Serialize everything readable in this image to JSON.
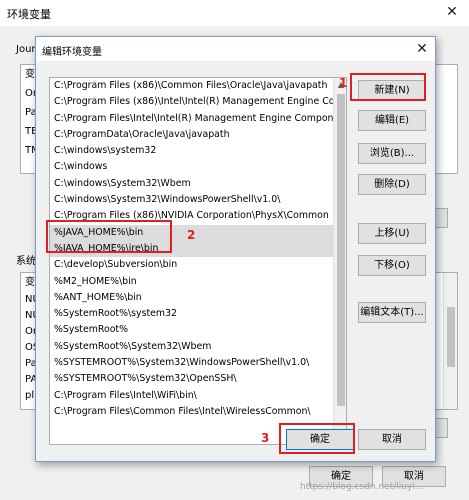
{
  "bg_window": {
    "title": "环境变量",
    "close_glyph": "✕",
    "user_group_label": "Jour",
    "user_vars": [
      "变",
      "Or",
      "Pa",
      "TE",
      "TM"
    ],
    "system_group_label": "系统",
    "system_vars": [
      "变",
      "NU",
      "NU",
      "Or",
      "OS",
      "Pa",
      "PA",
      "pl"
    ],
    "ok_label": "确定",
    "cancel_label": "取消",
    "watermark": "https://blog.csdn.net/liuyi..."
  },
  "dialog": {
    "title": "编辑环境变量",
    "close_glyph": "✕",
    "paths": [
      "C:\\Program Files (x86)\\Common Files\\Oracle\\Java\\javapath",
      "C:\\Program Files (x86)\\Intel\\Intel(R) Management Engine Co...",
      "C:\\Program Files\\Intel\\Intel(R) Management Engine Compon...",
      "C:\\ProgramData\\Oracle\\Java\\javapath",
      "C:\\windows\\system32",
      "C:\\windows",
      "C:\\windows\\System32\\Wbem",
      "C:\\windows\\System32\\WindowsPowerShell\\v1.0\\",
      "C:\\Program Files (x86)\\NVIDIA Corporation\\PhysX\\Common",
      "%JAVA_HOME%\\bin",
      "%JAVA_HOME%\\jre\\bin",
      "C:\\develop\\Subversion\\bin",
      "%M2_HOME%\\bin",
      "%ANT_HOME%\\bin",
      "%SystemRoot%\\system32",
      "%SystemRoot%",
      "%SystemRoot%\\System32\\Wbem",
      "%SYSTEMROOT%\\System32\\WindowsPowerShell\\v1.0\\",
      "%SYSTEMROOT%\\System32\\OpenSSH\\",
      "C:\\Program Files\\Intel\\WiFi\\bin\\",
      "C:\\Program Files\\Common Files\\Intel\\WirelessCommon\\"
    ],
    "buttons": {
      "new": "新建(N)",
      "edit": "编辑(E)",
      "browse": "浏览(B)...",
      "delete": "删除(D)",
      "move_up": "上移(U)",
      "move_down": "下移(O)",
      "edit_text": "编辑文本(T)...",
      "ok": "确定",
      "cancel": "取消"
    },
    "scroll_up_glyph": "▲",
    "scroll_down_glyph": "▼"
  },
  "annotations": {
    "marker_1": "1",
    "marker_2": "2",
    "marker_3": "3",
    "color": "#e02020"
  }
}
